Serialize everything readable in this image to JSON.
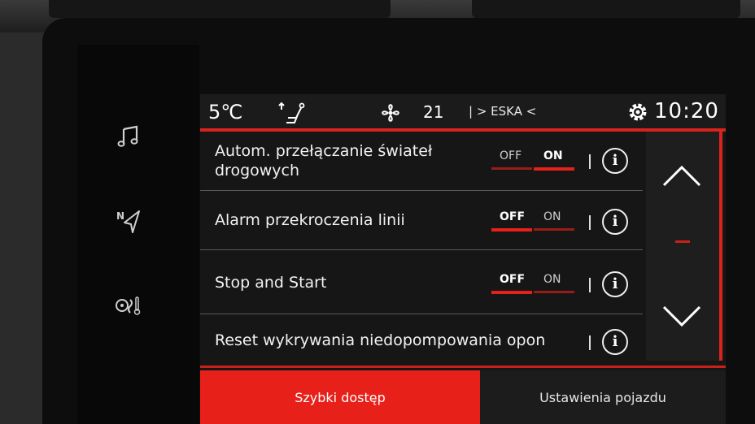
{
  "status": {
    "outside_temp": "5℃",
    "fan_level": "21",
    "radio": "| > ESKA <",
    "clock": "10:20",
    "icons": [
      "seat-airflow-icon",
      "fan-icon",
      "gear-icon"
    ]
  },
  "sidebar": {
    "icons": [
      "music-note-icon",
      "navigation-icon",
      "climate-icon"
    ]
  },
  "settings": [
    {
      "label_line1": "Autom. przełączanie świateł",
      "label_line2": "drogowych",
      "off_label": "OFF",
      "on_label": "ON",
      "state": "on"
    },
    {
      "label_line1": "Alarm przekroczenia linii",
      "off_label": "OFF",
      "on_label": "ON",
      "state": "off"
    },
    {
      "label_line1": "Stop and Start",
      "off_label": "OFF",
      "on_label": "ON",
      "state": "off"
    },
    {
      "label_line1": "Reset wykrywania niedopompowania opon"
    }
  ],
  "info_glyph": "i",
  "tabs": {
    "quick_access": "Szybki dostęp",
    "vehicle_settings": "Ustawienia pojazdu"
  },
  "colors": {
    "accent_red": "#e8201a",
    "background": "#161616",
    "text": "#f2f2f2"
  }
}
